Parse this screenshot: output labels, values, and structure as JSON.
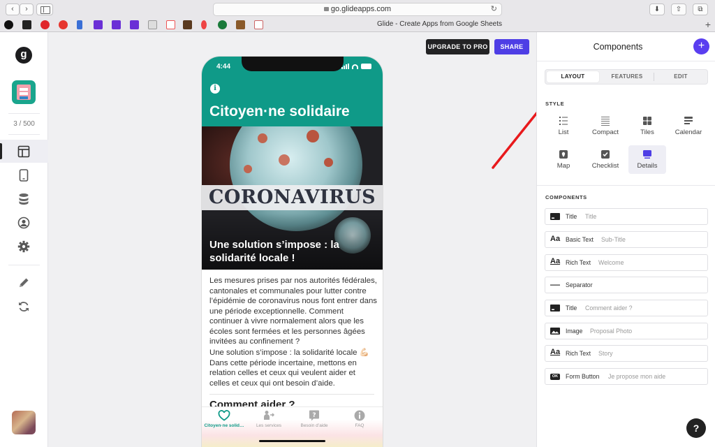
{
  "browser": {
    "url": "go.glideapps.com",
    "tab_title": "Glide - Create Apps from Google Sheets",
    "back_glyph": "‹",
    "forward_glyph": "›",
    "reload_glyph": "↻",
    "download_glyph": "⬇",
    "share_glyph": "⇧",
    "tabs_glyph": "⧉",
    "newtab_glyph": "+"
  },
  "sidebar": {
    "logo_letter": "g",
    "counter": "3 / 500"
  },
  "canvas": {
    "upgrade_label": "UPGRADE TO PRO",
    "share_label": "SHARE"
  },
  "phone": {
    "time": "4:44",
    "info_glyph": "i",
    "app_title": "Citoyen·ne solidaire",
    "hero_word": "CORONAVIRUS",
    "hero_caption": "Une solution s’impose : la solidarité locale !",
    "paragraph_1": "Les mesures prises par nos autorités fédérales, cantonales et communales pour lutter contre l’épidémie de coronavirus nous font entrer dans une période exceptionnelle. Comment continuer à vivre normalement alors que les écoles sont fermées et les personnes âgées invitées au confinement ?",
    "paragraph_2": "Une solution s’impose : la solidarité locale 💪🏻 Dans cette période incertaine, mettons en relation celles et ceux qui veulent aider et celles et ceux qui ont besoin d’aide.",
    "section_title": "Comment aider ?",
    "tabs": [
      {
        "label": "Citoyen·ne solid…"
      },
      {
        "label": "Les services"
      },
      {
        "label": "Besoin d’aide"
      },
      {
        "label": "FAQ"
      }
    ]
  },
  "panel": {
    "title": "Components",
    "add_glyph": "+",
    "segments": [
      "LAYOUT",
      "FEATURES",
      "EDIT"
    ],
    "style_label": "STYLE",
    "styles": [
      {
        "label": "List"
      },
      {
        "label": "Compact"
      },
      {
        "label": "Tiles"
      },
      {
        "label": "Calendar"
      },
      {
        "label": "Map"
      },
      {
        "label": "Checklist"
      },
      {
        "label": "Details"
      }
    ],
    "components_label": "COMPONENTS",
    "components": [
      {
        "name": "Title",
        "value": "Title",
        "icon": "title-icon"
      },
      {
        "name": "Basic Text",
        "value": "Sub-Title",
        "icon": "basic-text-icon"
      },
      {
        "name": "Rich Text",
        "value": "Welcome",
        "icon": "rich-text-icon"
      },
      {
        "name": "Separator",
        "value": "",
        "icon": "separator-icon"
      },
      {
        "name": "Title",
        "value": "Comment aider ?",
        "icon": "title-icon"
      },
      {
        "name": "Image",
        "value": "Proposal Photo",
        "icon": "image-icon"
      },
      {
        "name": "Rich Text",
        "value": "Story",
        "icon": "rich-text-icon"
      },
      {
        "name": "Form Button",
        "value": "Je propose mon aide",
        "icon": "form-button-icon"
      }
    ],
    "aa_glyph": "Aa",
    "ok_glyph": "OK",
    "help_glyph": "?"
  },
  "colors": {
    "accent": "#4e3ee5",
    "app_teal": "#0f9a88",
    "arrow": "#e8191c"
  }
}
